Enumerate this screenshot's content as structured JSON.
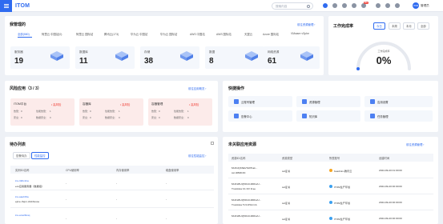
{
  "header": {
    "logo": "ITOM",
    "search_placeholder": "搜索内容",
    "notification_count": "99+",
    "avatar_text": "ITOM",
    "username": "管理员"
  },
  "managed": {
    "title": "我管理的",
    "link": "前往资源管理 ›",
    "tabs": [
      "全部(580)",
      "阿里云 中国站(0)",
      "阿里云 国际站",
      "腾讯云(173)",
      "华为云 中国站",
      "华为云 国际站",
      "AWS 中国站",
      "AWS 国际站",
      "天翼云",
      "Azure 国际站",
      "VMware vSphe"
    ],
    "stats": [
      {
        "label": "服务器",
        "value": "19"
      },
      {
        "label": "数据库",
        "value": "11"
      },
      {
        "label": "存储",
        "value": "38"
      },
      {
        "label": "数据",
        "value": "8"
      },
      {
        "label": "网络资源",
        "value": "61"
      }
    ]
  },
  "completion": {
    "title": "工作完成率",
    "periods": [
      "今日",
      "本周",
      "本月",
      "全部"
    ],
    "gauge_label": "工作完成率",
    "value": "0%",
    "fraction": 0
  },
  "risk": {
    "title": "风险应用（3 / 3）",
    "link": "前往应用概览 ›",
    "cards": [
      {
        "name": "ITOM平台",
        "badge": "• 高风险",
        "k1": "告警：",
        "v1": "0",
        "k2": "性能告警：",
        "v2": "1",
        "k3": "安全：",
        "v3": "0",
        "k4": "数据安全：",
        "v4": "0"
      },
      {
        "name": "容器库",
        "badge": "• 高风险",
        "k1": "告警：",
        "v1": "0",
        "k2": "性能告警：",
        "v2": "1",
        "k3": "安全：",
        "v3": "0",
        "k4": "数据安全：",
        "v4": "0"
      },
      {
        "name": "容器管理",
        "badge": "• 高风险",
        "k1": "告警：",
        "v1": "0",
        "k2": "性能告警：",
        "v2": "1",
        "k3": "安全：",
        "v3": "0",
        "k4": "数据安全：",
        "v4": "0"
      }
    ]
  },
  "quick": {
    "title": "快捷操作",
    "items": [
      "云账号管理",
      "资源管理",
      "应用设置",
      "告警中心",
      "知识库",
      "任务管理"
    ]
  },
  "todo": {
    "title": "待办列表",
    "tabs": [
      "告警待办",
      "性能监控"
    ],
    "link": "前往性能监控 ›",
    "columns": [
      "实例ID/名称",
      "CPU使用率",
      "内存使用率",
      "磁盘使用率"
    ],
    "rows": [
      {
        "id": "ins-32bc2xa",
        "name": "ecs应用服务器（数据组）",
        "cpu": "-",
        "mem": "-",
        "disk": "-"
      },
      {
        "id": "ins-aaubhhe",
        "name": "ejme-rbqm-clickhouse",
        "cpu": "-",
        "mem": "-",
        "disk": "-"
      },
      {
        "id": "ins-ans24knq",
        "name": "",
        "cpu": "-",
        "mem": "-",
        "disk": "-"
      }
    ]
  },
  "unlinked": {
    "title": "未关联应用资源",
    "link": "前往资源管理 ›",
    "columns": [
      "资源ID/名称",
      "资源类型",
      "所属账号",
      "创建时间"
    ],
    "rows": [
      {
        "id": "MUKJQK6EVSzPKak...",
        "name": "ssl-I1B0D1N",
        "type": "ssl证书",
        "account": "beadmin-腾讯云",
        "time": "2024-09-20 01:00:00"
      },
      {
        "id": "MUFLBUQ50UUJZ0FwU...",
        "name": "TrustAsia C1 DV Free",
        "type": "ssl证书",
        "account": "ITOM生产环境",
        "time": "2024-09-20 00:00:00"
      },
      {
        "id": "MUFLBUQ50UUJZ0FwU...",
        "name": "TrustAsia TLS RSA CA",
        "type": "ssl证书",
        "account": "ITOM生产环境",
        "time": "2024-09-20 00:00:00"
      },
      {
        "id": "MUFLBUQ50UUJZ0FwU...",
        "name": "",
        "type": "ssl证书",
        "account": "ITOM生产环境",
        "time": "2024-09-20 00:00:00"
      }
    ]
  }
}
